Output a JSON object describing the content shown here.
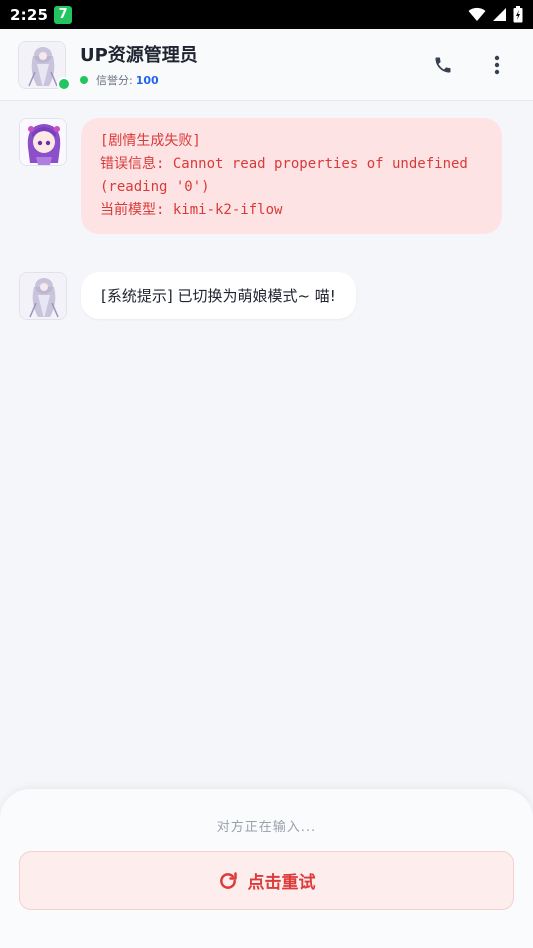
{
  "status_bar": {
    "time": "2:25",
    "app_icon_glyph": "7",
    "icons": [
      "wifi-icon",
      "signal-icon",
      "battery-icon"
    ]
  },
  "header": {
    "title": "UP资源管理员",
    "credit_label": "信誉分:",
    "credit_value": "100",
    "online_color": "#22c55e",
    "actions": [
      "phone-icon",
      "more-vertical-icon"
    ]
  },
  "messages": [
    {
      "type": "error",
      "lines": [
        "[剧情生成失败]",
        "错误信息: Cannot read properties of undefined",
        "(reading '0')",
        "当前模型: kimi-k2-iflow"
      ]
    },
    {
      "type": "system",
      "text": "[系统提示] 已切换为萌娘模式~ 喵!"
    }
  ],
  "footer": {
    "typing_text": "对方正在输入...",
    "retry_label": "点击重试"
  },
  "colors": {
    "accent_blue": "#2563eb",
    "error_red": "#dc3b3b",
    "error_bg": "#fde3e3"
  }
}
